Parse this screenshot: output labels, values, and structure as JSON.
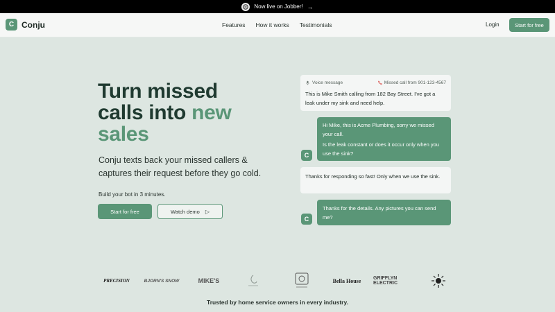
{
  "announcement": {
    "text": "Now live on Jobber!",
    "arrow": "→"
  },
  "nav": {
    "brand_mark": "C",
    "brand_name": "Conju",
    "links": [
      "Features",
      "How it works",
      "Testimonials"
    ],
    "login": "Login",
    "cta": "Start for free"
  },
  "hero": {
    "title_line1": "Turn missed",
    "title_line2_a": "calls into ",
    "title_line2_b": "new",
    "title_line3": "sales",
    "subtitle": "Conju texts back your missed callers & captures their request before they go cold.",
    "note": "Build your bot in 3 minutes.",
    "primary_cta": "Start for free",
    "secondary_cta": "Watch demo"
  },
  "chat": {
    "voice_label": "Voice message",
    "missed_call_label": "Missed call from 901-123-4567",
    "messages": [
      {
        "from": "customer",
        "text": "This is Mike Smith calling from 182 Bay Street. I've got a leak under my sink and need help."
      },
      {
        "from": "bot",
        "text": "Hi Mike, this is Acme Plumbing, sorry we missed your call.",
        "text2": "Is the leak constant or does it occur only when you use the sink?"
      },
      {
        "from": "customer",
        "text": "Thanks for responding so fast! Only when we use the sink."
      },
      {
        "from": "bot",
        "text": "Thanks for the details. Any pictures you can send me?"
      }
    ],
    "avatar_letter": "C"
  },
  "logos": {
    "precision": "PRECISION",
    "bjorn": "BJORN'S SNOW",
    "mikes": "MIKE'S",
    "bella": "Bella House",
    "grifflyn": "GRIFFLYN ELECTRIC"
  },
  "trusted_text": "Trusted by home service owners in every industry.",
  "colors": {
    "accent": "#5a9677",
    "background": "#dde6e1",
    "headline": "#1f3a30"
  }
}
